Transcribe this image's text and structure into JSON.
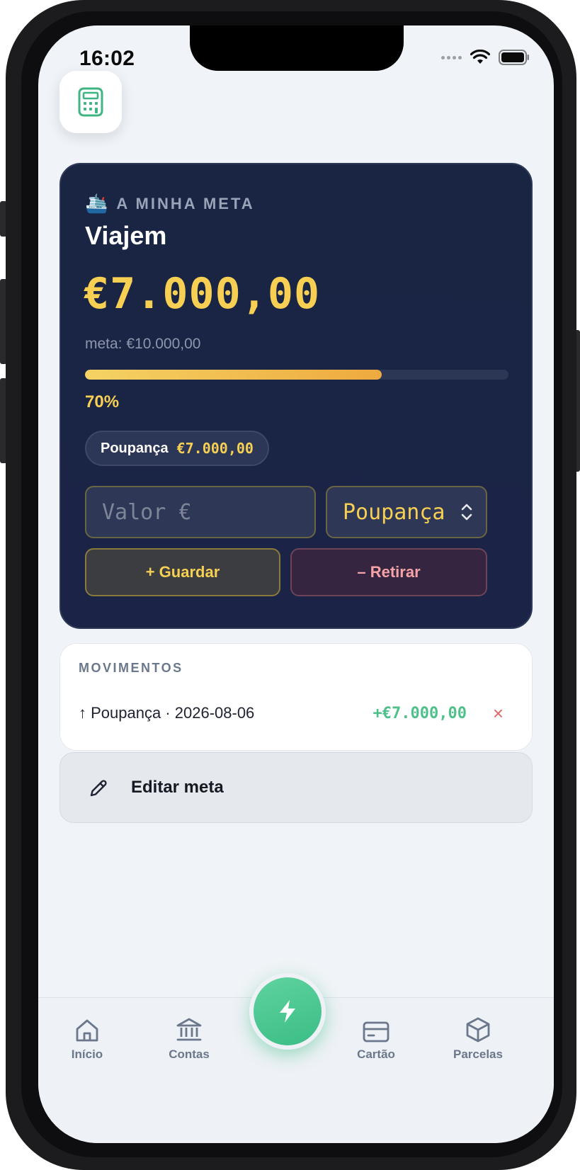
{
  "status_bar": {
    "time": "16:02"
  },
  "goal": {
    "eyebrow": "A MINHA META",
    "emoji": "🛳️",
    "name": "Viajem",
    "amount": "€7.000,00",
    "target": "meta: €10.000,00",
    "progress_percent": 70,
    "progress_label": "70%",
    "chip": {
      "account": "Poupança",
      "value": "€7.000,00"
    },
    "input_placeholder": "Valor €",
    "selected_account": "Poupança",
    "save_label": "+ Guardar",
    "withdraw_label": "– Retirar"
  },
  "movements": {
    "title": "MOVIMENTOS",
    "items": [
      {
        "description": "↑ Poupança · 2026-08-06",
        "amount": "+€7.000,00",
        "delete": "×"
      }
    ]
  },
  "edit": {
    "label": "Editar meta"
  },
  "tabbar": {
    "tabs": [
      {
        "label": "Início",
        "icon": "home-icon"
      },
      {
        "label": "Contas",
        "icon": "bank-icon"
      },
      {
        "label": "Cartão",
        "icon": "credit-card-icon"
      },
      {
        "label": "Parcelas",
        "icon": "box-icon"
      }
    ],
    "fab_icon": "lightning-icon"
  },
  "colors": {
    "accent_gold": "#f6cf53",
    "accent_green": "#4fc08a",
    "danger": "#e0686a",
    "card_bg": "#1a2544"
  }
}
